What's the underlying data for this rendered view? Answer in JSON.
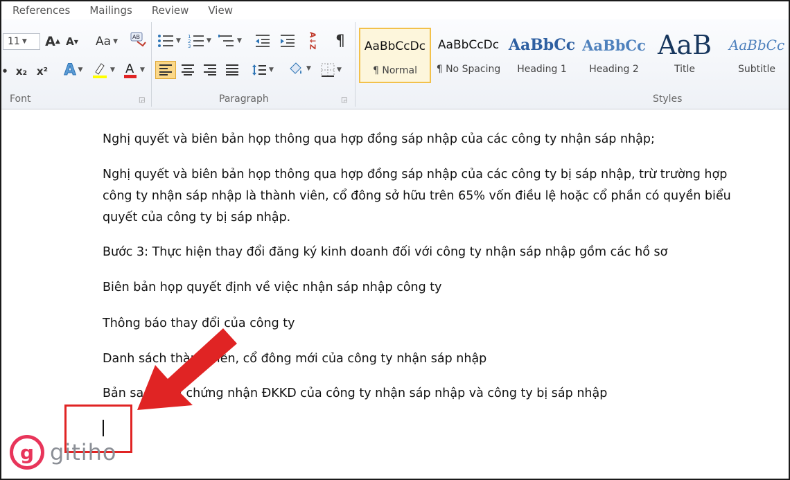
{
  "tabs": [
    "References",
    "Mailings",
    "Review",
    "View"
  ],
  "font": {
    "size": "11",
    "grow_label": "A",
    "shrink_label": "A",
    "case_label": "Aa",
    "subscript_label": "x₂",
    "superscript_label": "x²",
    "group_label": "Font"
  },
  "paragraph": {
    "group_label": "Paragraph",
    "sort_label": "A↓Z",
    "pilcrow": "¶"
  },
  "styles": {
    "group_label": "Styles",
    "items": [
      {
        "preview": "AaBbCcDc",
        "name": "¶ Normal"
      },
      {
        "preview": "AaBbCcDc",
        "name": "¶ No Spacing"
      },
      {
        "preview": "AaBbCc",
        "name": "Heading 1"
      },
      {
        "preview": "AaBbCc",
        "name": "Heading 2"
      },
      {
        "preview": "AaB",
        "name": "Title"
      },
      {
        "preview": "AaBbCc",
        "name": "Subtitle"
      }
    ]
  },
  "document": {
    "p1": "Nghị quyết và biên bản họp thông qua hợp đồng sáp nhập của các công ty nhận sáp nhập;",
    "p2_l1": "Nghị quyết và biên bản họp thông qua hợp đồng sáp nhập của các công ty bị sáp nhập, trừ trường hợp",
    "p2_l2": "công ty nhận sáp nhập là thành viên, cổ đông sở hữu trên 65% vốn điều lệ hoặc cổ phần có quyền biểu",
    "p2_l3": "quyết của công ty bị sáp nhập.",
    "p3": "Bước 3: Thực hiện thay đổi đăng ký kinh doanh đối với công ty nhận sáp nhập gồm các hồ sơ",
    "p4": "Biên bản họp quyết định về việc nhận sáp nhập công ty",
    "p5": "Thông báo thay đổi của công ty",
    "p6": "Danh sách thành viên, cổ đông mới của công ty nhận sáp nhập",
    "p7": "Bản sao Giấy chứng nhận ĐKKD của công ty nhận sáp nhập và công ty bị sáp nhập"
  },
  "colors": {
    "highlight": "#f2c14b",
    "annotation": "#e02424",
    "logo": "#e8355a"
  },
  "logo": {
    "mark": "g",
    "text": "gitiho"
  }
}
